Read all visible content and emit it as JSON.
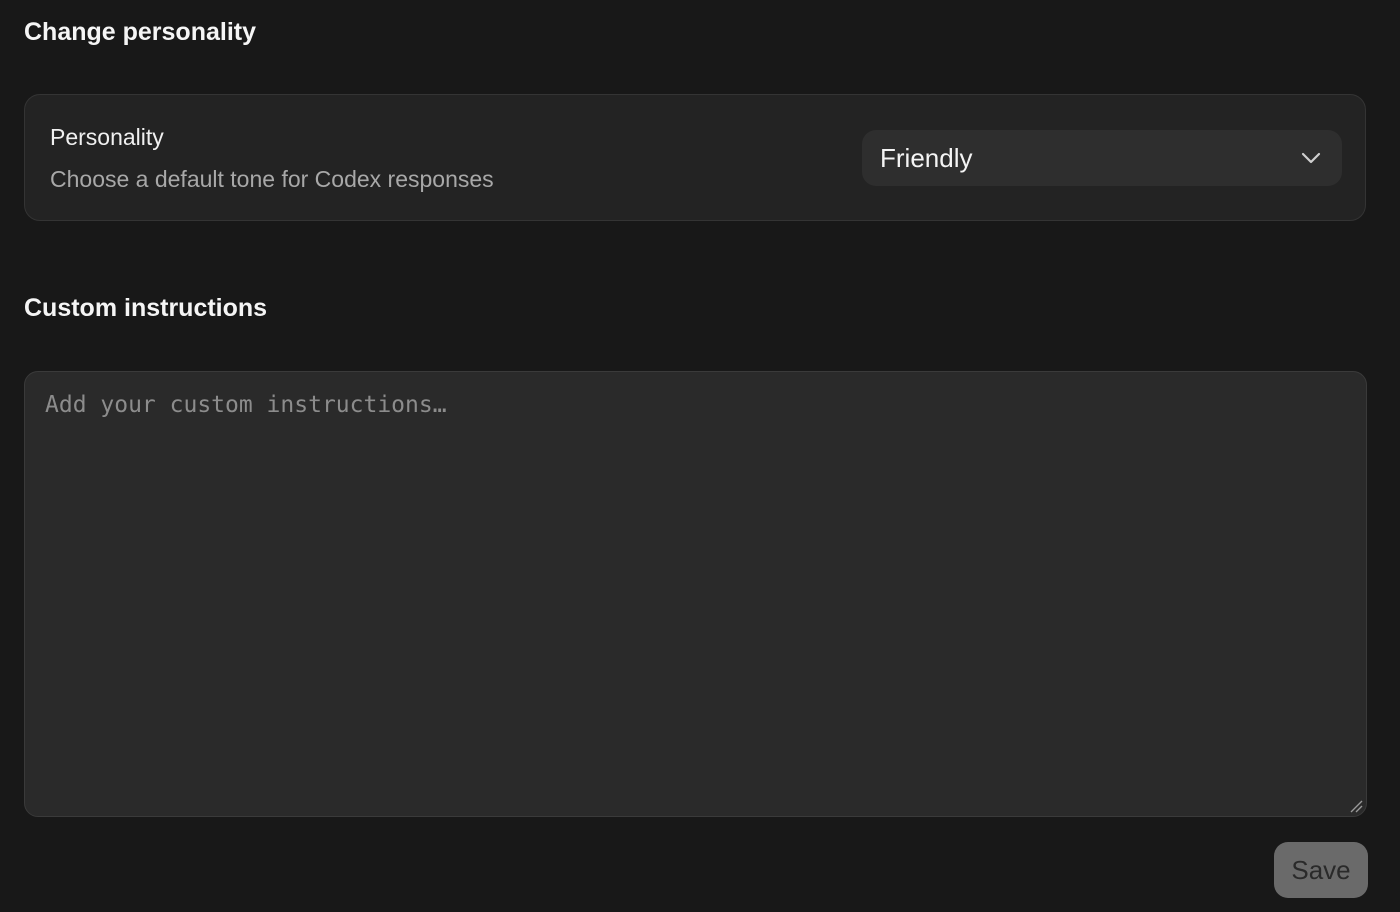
{
  "personality_section": {
    "title": "Change personality",
    "card": {
      "label": "Personality",
      "description": "Choose a default tone for Codex responses",
      "select": {
        "value": "Friendly",
        "icon": "chevron-down-icon"
      }
    }
  },
  "custom_section": {
    "title": "Custom instructions",
    "textarea": {
      "value": "",
      "placeholder": "Add your custom instructions…",
      "resize_icon": "resize-handle-icon"
    },
    "save_label": "Save"
  },
  "colors": {
    "background": "#181818",
    "card_background": "#232323",
    "select_background": "#2e2e2e",
    "textarea_background": "#2a2a2a",
    "save_button_background": "#6a6a6a",
    "secondary_text": "#a8a8a8",
    "placeholder_text": "#8c8c8c"
  }
}
